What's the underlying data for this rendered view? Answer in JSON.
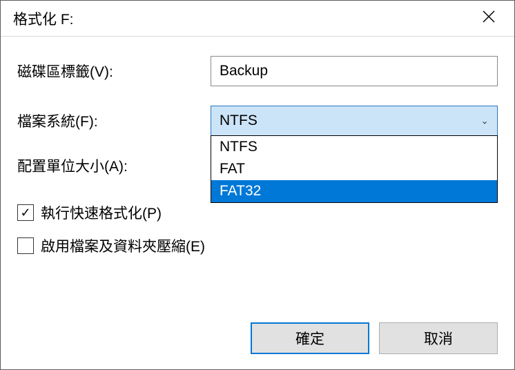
{
  "title": "格式化 F:",
  "labels": {
    "volume": "磁碟區標籤(V):",
    "filesystem": "檔案系統(F):",
    "allocation": "配置單位大小(A):"
  },
  "inputs": {
    "volume_value": "Backup",
    "filesystem_selected": "NTFS"
  },
  "dropdown_options": [
    "NTFS",
    "FAT",
    "FAT32"
  ],
  "dropdown_highlight_index": 2,
  "checkboxes": {
    "quick_format": {
      "label": "執行快速格式化(P)",
      "checked": true
    },
    "compression": {
      "label": "啟用檔案及資料夾壓縮(E)",
      "checked": false
    }
  },
  "buttons": {
    "ok": "確定",
    "cancel": "取消"
  }
}
